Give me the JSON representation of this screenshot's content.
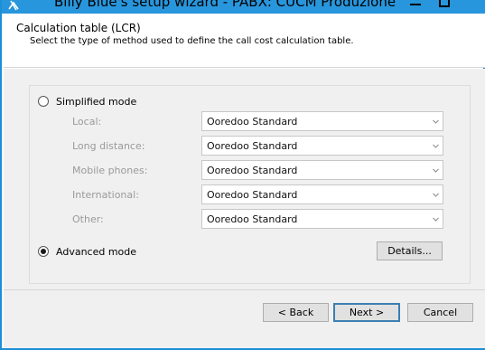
{
  "window": {
    "title": "Billy Blue's setup wizard -  PABX: CUCM Produzione",
    "icon": "wizard-app-icon",
    "accent_color": "#2896dc"
  },
  "header": {
    "title": "Calculation table (LCR)",
    "subtitle": "Select the type of method used to define the call cost calculation table."
  },
  "modes": {
    "simplified": {
      "label": "Simplified mode",
      "selected": false
    },
    "advanced": {
      "label": "Advanced mode",
      "selected": true
    }
  },
  "rows": [
    {
      "label": "Local:",
      "value": "Ooredoo Standard"
    },
    {
      "label": "Long distance:",
      "value": "Ooredoo Standard"
    },
    {
      "label": "Mobile phones:",
      "value": "Ooredoo Standard"
    },
    {
      "label": "International:",
      "value": "Ooredoo Standard"
    },
    {
      "label": "Other:",
      "value": "Ooredoo Standard"
    }
  ],
  "buttons": {
    "details": "Details...",
    "back": "< Back",
    "next": "Next >",
    "cancel": "Cancel"
  }
}
